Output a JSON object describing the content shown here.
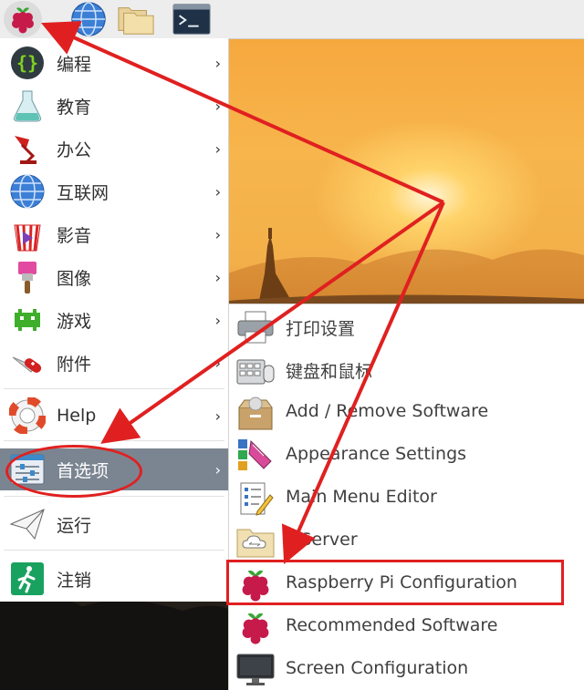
{
  "colors": {
    "panel_bg": "#ededed",
    "menu_active_bg": "#7b8591",
    "annotation_red": "#e02020"
  },
  "panel": {
    "buttons": [
      {
        "icon": "raspberry-icon"
      },
      {
        "icon": "globe-icon"
      },
      {
        "icon": "folders-icon"
      },
      {
        "icon": "terminal-icon"
      }
    ]
  },
  "main_menu": {
    "items": [
      {
        "label": "编程",
        "icon": "code-braces-icon",
        "has_submenu": true
      },
      {
        "label": "教育",
        "icon": "flask-icon",
        "has_submenu": true
      },
      {
        "label": "办公",
        "icon": "desk-lamp-icon",
        "has_submenu": true
      },
      {
        "label": "互联网",
        "icon": "globe-icon",
        "has_submenu": true
      },
      {
        "label": "影音",
        "icon": "popcorn-icon",
        "has_submenu": true
      },
      {
        "label": "图像",
        "icon": "paintbrush-icon",
        "has_submenu": true
      },
      {
        "label": "游戏",
        "icon": "space-invader-icon",
        "has_submenu": true
      },
      {
        "label": "附件",
        "icon": "swiss-knife-icon",
        "has_submenu": true
      },
      {
        "label": "Help",
        "icon": "lifebuoy-icon",
        "has_submenu": true
      },
      {
        "label": "首选项",
        "icon": "preferences-icon",
        "has_submenu": true,
        "active": true
      },
      {
        "label": "运行",
        "icon": "paper-plane-icon",
        "has_submenu": false
      },
      {
        "label": "注销",
        "icon": "exit-running-man-icon",
        "has_submenu": false
      }
    ]
  },
  "sub_menu": {
    "items": [
      {
        "label": "打印设置",
        "icon": "printer-icon"
      },
      {
        "label": "键盘和鼠标",
        "icon": "keyboard-mouse-icon"
      },
      {
        "label": "Add / Remove Software",
        "icon": "software-box-icon"
      },
      {
        "label": "Appearance Settings",
        "icon": "appearance-palette-icon"
      },
      {
        "label": "Main Menu Editor",
        "icon": "menu-editor-icon"
      },
      {
        "label": "PiServer",
        "icon": "cloud-folder-icon"
      },
      {
        "label": "Raspberry Pi Configuration",
        "icon": "raspberry-icon",
        "highlighted": true
      },
      {
        "label": "Recommended Software",
        "icon": "raspberry-icon"
      },
      {
        "label": "Screen Configuration",
        "icon": "monitor-icon"
      }
    ]
  },
  "arrow_glyph": "›"
}
